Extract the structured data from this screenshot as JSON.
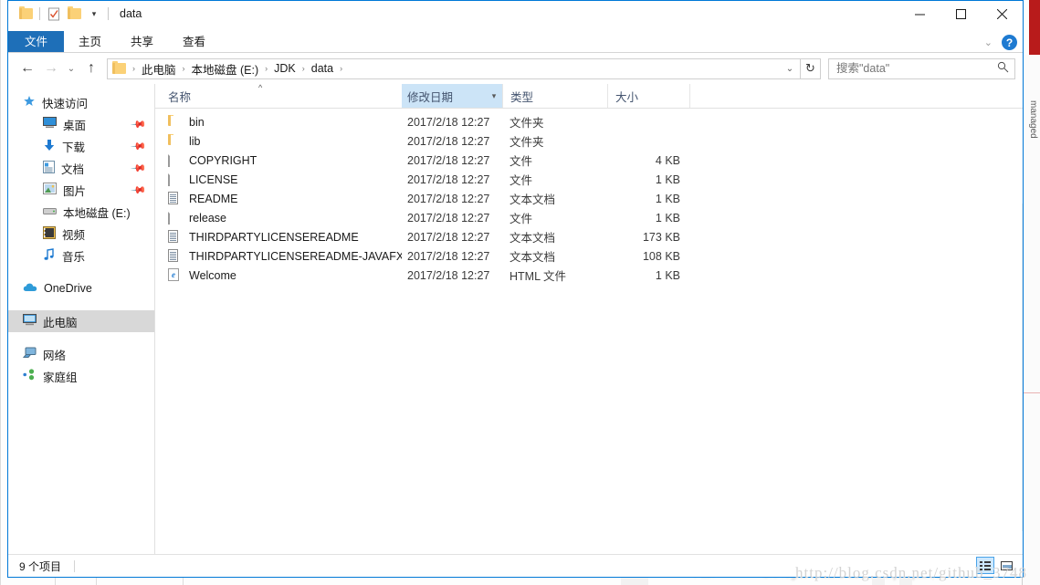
{
  "window": {
    "title": "data",
    "quick_access": [
      "folder-icon",
      "properties-icon",
      "new-folder-icon",
      "dropdown-arrow"
    ],
    "controls": {
      "minimize": "—",
      "maximize": "☐",
      "close": "✕"
    }
  },
  "ribbon": {
    "tabs": [
      {
        "label": "文件",
        "active": true
      },
      {
        "label": "主页",
        "active": false
      },
      {
        "label": "共享",
        "active": false
      },
      {
        "label": "查看",
        "active": false
      }
    ],
    "collapse_chevron": "⌄",
    "help_label": "?"
  },
  "address": {
    "back": "←",
    "forward": "→",
    "recent": "⌄",
    "up": "↑",
    "breadcrumbs": [
      "此电脑",
      "本地磁盘 (E:)",
      "JDK",
      "data"
    ],
    "separator": "›",
    "dropdown": "⌄",
    "refresh": "↻",
    "search_placeholder": "搜索\"data\"",
    "search_value": "",
    "search_icon": "⌕"
  },
  "sidebar": {
    "items": [
      {
        "label": "快速访问",
        "icon": "star-icon",
        "level": "root",
        "pinned": false,
        "selected": false
      },
      {
        "label": "桌面",
        "icon": "desktop-icon",
        "level": "sub",
        "pinned": true,
        "selected": false
      },
      {
        "label": "下载",
        "icon": "download-icon",
        "level": "sub",
        "pinned": true,
        "selected": false
      },
      {
        "label": "文档",
        "icon": "documents-icon",
        "level": "sub",
        "pinned": true,
        "selected": false
      },
      {
        "label": "图片",
        "icon": "pictures-icon",
        "level": "sub",
        "pinned": true,
        "selected": false
      },
      {
        "label": "本地磁盘 (E:)",
        "icon": "drive-icon",
        "level": "sub",
        "pinned": false,
        "selected": false
      },
      {
        "label": "视频",
        "icon": "video-icon",
        "level": "sub",
        "pinned": false,
        "selected": false
      },
      {
        "label": "音乐",
        "icon": "music-icon",
        "level": "sub",
        "pinned": false,
        "selected": false
      },
      {
        "label": "OneDrive",
        "icon": "onedrive-icon",
        "level": "root",
        "pinned": false,
        "selected": false
      },
      {
        "label": "此电脑",
        "icon": "thispc-icon",
        "level": "root",
        "pinned": false,
        "selected": true
      },
      {
        "label": "网络",
        "icon": "network-icon",
        "level": "root",
        "pinned": false,
        "selected": false
      },
      {
        "label": "家庭组",
        "icon": "homegroup-icon",
        "level": "root",
        "pinned": false,
        "selected": false
      }
    ]
  },
  "filelist": {
    "columns": [
      {
        "label": "名称",
        "key": "name",
        "sorted": true,
        "sort_dir": "asc"
      },
      {
        "label": "修改日期",
        "key": "date",
        "highlighted": true
      },
      {
        "label": "类型",
        "key": "type"
      },
      {
        "label": "大小",
        "key": "size"
      }
    ],
    "sort_caret": "^",
    "rows": [
      {
        "name": "bin",
        "icon": "folder-icon",
        "date": "2017/2/18 12:27",
        "type": "文件夹",
        "size": ""
      },
      {
        "name": "lib",
        "icon": "folder-icon",
        "date": "2017/2/18 12:27",
        "type": "文件夹",
        "size": ""
      },
      {
        "name": "COPYRIGHT",
        "icon": "file-icon",
        "date": "2017/2/18 12:27",
        "type": "文件",
        "size": "4 KB"
      },
      {
        "name": "LICENSE",
        "icon": "file-icon",
        "date": "2017/2/18 12:27",
        "type": "文件",
        "size": "1 KB"
      },
      {
        "name": "README",
        "icon": "text-icon",
        "date": "2017/2/18 12:27",
        "type": "文本文档",
        "size": "1 KB"
      },
      {
        "name": "release",
        "icon": "file-icon",
        "date": "2017/2/18 12:27",
        "type": "文件",
        "size": "1 KB"
      },
      {
        "name": "THIRDPARTYLICENSEREADME",
        "icon": "text-icon",
        "date": "2017/2/18 12:27",
        "type": "文本文档",
        "size": "173 KB"
      },
      {
        "name": "THIRDPARTYLICENSEREADME-JAVAFX",
        "icon": "text-icon",
        "date": "2017/2/18 12:27",
        "type": "文本文档",
        "size": "108 KB"
      },
      {
        "name": "Welcome",
        "icon": "html-icon",
        "date": "2017/2/18 12:27",
        "type": "HTML 文件",
        "size": "1 KB"
      }
    ]
  },
  "statusbar": {
    "item_count": "9 个项目",
    "view_details_title": "details-view",
    "view_large_title": "large-icons-view"
  },
  "watermark": {
    "text": "http://blog.csdn.net/github_3748"
  }
}
